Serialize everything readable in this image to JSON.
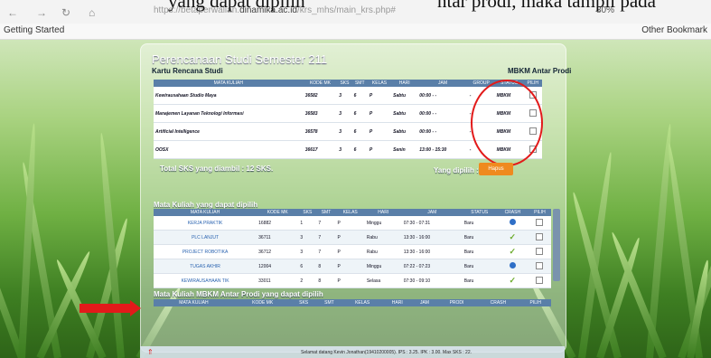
{
  "caption": {
    "left": "yang dapat dipilih",
    "right": "ntar prodi, maka tampil pada"
  },
  "browser": {
    "url_prefix": "https://betaperwalian.",
    "url_domain": "dinamika.ac.id",
    "url_path": "/krs_mhs/main_krs.php#",
    "zoom": "80%",
    "bookmark_left": "Getting Started",
    "bookmark_right": "Other Bookmark"
  },
  "page": {
    "title": "Perencanaan Studi Semester 211",
    "krs_label": "Kartu Rencana Studi",
    "mbkm_label": "MBKM Antar Prodi",
    "total_sks": "Total SKS yang diambil : 12 SKS.",
    "yang_dipilih": "Yang dipilih :",
    "hapus": "Hapus",
    "section_available": "Mata Kuliah yang dapat dipilih",
    "section_mbkm": "Mata Kuliah MBKM Antar Prodi yang dapat dipilih",
    "status_bar": "Selamat datang Kevin Jonathan(19410200005). IPS : 3.25. IPK : 3.00. Max SKS : 22."
  },
  "krs_table": {
    "headers": [
      "MATA KULIAH",
      "KODE MK",
      "SKS",
      "SMT",
      "KELAS",
      "HARI",
      "JAM",
      "GROUP",
      "STATUS",
      "PILIH"
    ],
    "rows": [
      [
        "Kewirausahaan Studio Maya",
        "36582",
        "3",
        "6",
        "P",
        "Sabtu",
        "00:00 - -",
        "-",
        "MBKM",
        ""
      ],
      [
        "Manajemen Layanan Teknologi Informasi",
        "36583",
        "3",
        "6",
        "P",
        "Sabtu",
        "00:00 - -",
        "-",
        "MBKM",
        ""
      ],
      [
        "Artificial Intelligence",
        "36578",
        "3",
        "6",
        "P",
        "Sabtu",
        "00:00 - -",
        "-",
        "MBKM",
        ""
      ],
      [
        "OOSX",
        "36617",
        "3",
        "6",
        "P",
        "Senin",
        "13:00 - 15:30",
        "-",
        "MBKM",
        ""
      ]
    ]
  },
  "available_table": {
    "headers": [
      "MATA KULIAH",
      "KODE MK",
      "SKS",
      "SMT",
      "KELAS",
      "HARI",
      "JAM",
      "STATUS",
      "CRASH",
      "PILIH"
    ],
    "rows": [
      [
        "KERJA PRAKTIK",
        "16882",
        "1",
        "7",
        "P",
        "Minggu",
        "07:30 - 07:31",
        "Baru",
        "blue",
        ""
      ],
      [
        "PLC LANJUT",
        "36711",
        "3",
        "7",
        "P",
        "Rabu",
        "13:30 - 16:00",
        "Baru",
        "check",
        ""
      ],
      [
        "PROJECT ROBOTIKA",
        "36712",
        "3",
        "7",
        "P",
        "Rabu",
        "13:30 - 16:00",
        "Baru",
        "check",
        ""
      ],
      [
        "TUGAS AKHIR",
        "12004",
        "6",
        "8",
        "P",
        "Minggu",
        "07:22 - 07:23",
        "Baru",
        "blue",
        ""
      ],
      [
        "KEWIRAUSAHAAN TIK",
        "33011",
        "2",
        "8",
        "P",
        "Selasa",
        "07:30 - 09:10",
        "Baru",
        "check",
        ""
      ]
    ]
  },
  "mbkm_table": {
    "headers": [
      "MATA KULIAH",
      "KODE MK",
      "SKS",
      "SMT",
      "KELAS",
      "HARI",
      "JAM",
      "PRODI",
      "CRASH",
      "PILIH"
    ]
  },
  "colors": {
    "annotation": "#e21a1a",
    "button": "#ef8a1f",
    "header": "#5a7fa8"
  }
}
